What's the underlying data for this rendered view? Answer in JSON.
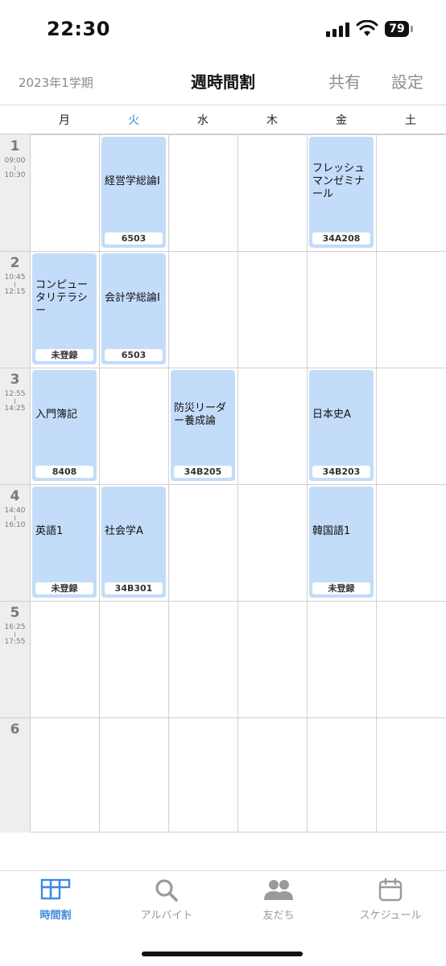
{
  "status": {
    "time": "22:30",
    "battery": "79"
  },
  "header": {
    "term": "2023年1学期",
    "title": "週時間割",
    "share": "共有",
    "settings": "設定"
  },
  "days": [
    "月",
    "火",
    "水",
    "木",
    "金",
    "土"
  ],
  "periods": [
    {
      "num": "1",
      "start": "09:00",
      "end": "10:30"
    },
    {
      "num": "2",
      "start": "10:45",
      "end": "12:15"
    },
    {
      "num": "3",
      "start": "12:55",
      "end": "14:25"
    },
    {
      "num": "4",
      "start": "14:40",
      "end": "16:10"
    },
    {
      "num": "5",
      "start": "16:25",
      "end": "17:55"
    },
    {
      "num": "6",
      "start": "",
      "end": ""
    }
  ],
  "courses": [
    {
      "day": 1,
      "period": 0,
      "name": "経営学総論I",
      "room": "6503"
    },
    {
      "day": 4,
      "period": 0,
      "name": "フレッシュマンゼミナール",
      "room": "34A208"
    },
    {
      "day": 0,
      "period": 1,
      "name": "コンピュータリテラシー",
      "room": "未登録"
    },
    {
      "day": 1,
      "period": 1,
      "name": "会計学総論I",
      "room": "6503"
    },
    {
      "day": 0,
      "period": 2,
      "name": "入門簿記",
      "room": "8408"
    },
    {
      "day": 2,
      "period": 2,
      "name": "防災リーダー養成論",
      "room": "34B205"
    },
    {
      "day": 4,
      "period": 2,
      "name": "日本史A",
      "room": "34B203"
    },
    {
      "day": 0,
      "period": 3,
      "name": "英語1",
      "room": "未登録"
    },
    {
      "day": 1,
      "period": 3,
      "name": "社会学A",
      "room": "34B301"
    },
    {
      "day": 4,
      "period": 3,
      "name": "韓国語1",
      "room": "未登録"
    }
  ],
  "tabs": [
    {
      "label": "時間割",
      "icon": "timetable-icon",
      "active": true
    },
    {
      "label": "アルバイト",
      "icon": "search-icon",
      "active": false
    },
    {
      "label": "友だち",
      "icon": "friends-icon",
      "active": false
    },
    {
      "label": "スケジュール",
      "icon": "calendar-icon",
      "active": false
    }
  ],
  "colors": {
    "accent": "#3f8ae0",
    "course_bg": "#c3dcf9",
    "period_col_bg": "#eeeef0"
  }
}
